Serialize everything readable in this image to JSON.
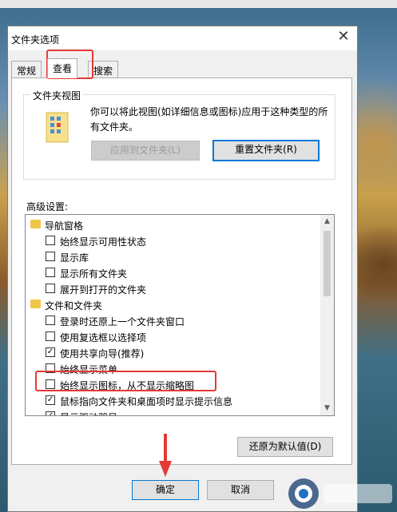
{
  "dialog": {
    "title": "文件夹选项",
    "close_glyph": "✕",
    "tabs": [
      {
        "label": "常规"
      },
      {
        "label": "查看"
      },
      {
        "label": "搜索"
      }
    ],
    "folder_views": {
      "legend": "文件夹视图",
      "description": "你可以将此视图(如详细信息或图标)应用于这种类型的所有文件夹。",
      "apply_button": "应用到文件夹(L)",
      "reset_button": "重置文件夹(R)"
    },
    "advanced": {
      "label": "高级设置:",
      "items": [
        {
          "type": "folder",
          "text": "导航窗格"
        },
        {
          "type": "check",
          "checked": false,
          "text": "始终显示可用性状态"
        },
        {
          "type": "check",
          "checked": false,
          "text": "显示库"
        },
        {
          "type": "check",
          "checked": false,
          "text": "显示所有文件夹"
        },
        {
          "type": "check",
          "checked": false,
          "text": "展开到打开的文件夹"
        },
        {
          "type": "folder",
          "text": "文件和文件夹"
        },
        {
          "type": "check",
          "checked": false,
          "text": "登录时还原上一个文件夹窗口"
        },
        {
          "type": "check",
          "checked": false,
          "text": "使用复选框以选择项"
        },
        {
          "type": "check",
          "checked": true,
          "text": "使用共享向导(推荐)"
        },
        {
          "type": "check",
          "checked": false,
          "text": "始终显示菜单"
        },
        {
          "type": "check",
          "checked": false,
          "text": "始终显示图标，从不显示缩略图"
        },
        {
          "type": "check",
          "checked": true,
          "text": "鼠标指向文件夹和桌面项时显示提示信息"
        },
        {
          "type": "check",
          "checked": true,
          "text": "显示驱动器号"
        }
      ],
      "check_glyph": "✓"
    },
    "restore_defaults_button": "还原为默认值(D)",
    "ok_button": "确定",
    "cancel_button": "取消"
  },
  "annotation_color": "#e53935"
}
